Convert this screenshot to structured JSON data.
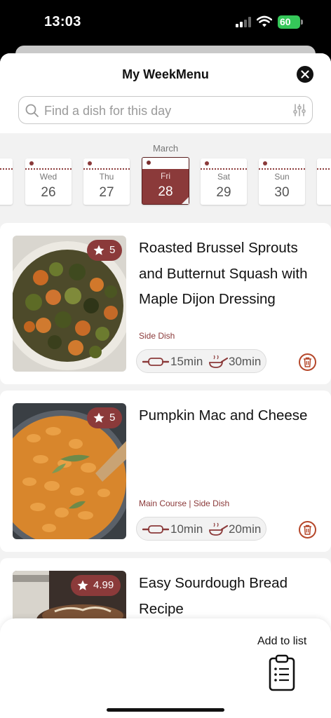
{
  "status_bar": {
    "time": "13:03",
    "battery": "60"
  },
  "header": {
    "title": "My WeekMenu",
    "search_placeholder": "Find a dish for this day"
  },
  "date_strip": {
    "month": "March",
    "days": [
      {
        "weekday": "Wed",
        "day": "26"
      },
      {
        "weekday": "Thu",
        "day": "27"
      },
      {
        "weekday": "Fri",
        "day": "28",
        "selected": true
      },
      {
        "weekday": "Sat",
        "day": "29"
      },
      {
        "weekday": "Sun",
        "day": "30"
      }
    ]
  },
  "recipes": [
    {
      "title": "Roasted Brussel Sprouts and Butternut Squash with Maple Dijon Dressing",
      "rating": "5",
      "category": "Side Dish",
      "prep_time": "15min",
      "cook_time": "30min"
    },
    {
      "title": "Pumpkin Mac and Cheese",
      "rating": "5",
      "category": "Main Course | Side Dish",
      "prep_time": "10min",
      "cook_time": "20min"
    },
    {
      "title": "Easy Sourdough Bread Recipe",
      "rating": "4.99"
    }
  ],
  "bottom_bar": {
    "add_to_list_label": "Add to list"
  },
  "colors": {
    "accent": "#8b3a3a",
    "delete": "#b5472a",
    "battery": "#35c759"
  },
  "icons": [
    "signal-icon",
    "wifi-icon",
    "close-icon",
    "search-icon",
    "filter-icon",
    "star-icon",
    "rolling-pin-icon",
    "pan-icon",
    "trash-icon",
    "clipboard-icon"
  ]
}
